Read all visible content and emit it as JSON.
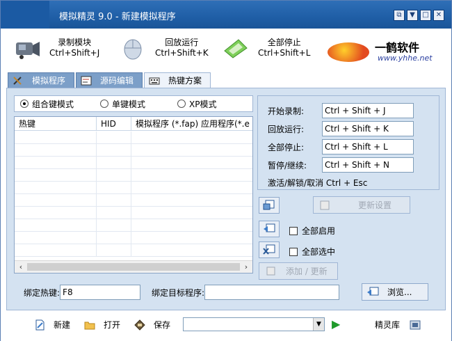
{
  "window": {
    "title": "模拟精灵 9.0 - 新建模拟程序",
    "controls": [
      "restore",
      "minimize",
      "maximize",
      "close"
    ]
  },
  "toolbar": {
    "record": {
      "label": "录制模块",
      "shortcut": "Ctrl+Shift+J",
      "icon": "camera-icon"
    },
    "playback": {
      "label": "回放运行",
      "shortcut": "Ctrl+Shift+K",
      "icon": "mouse-icon"
    },
    "stop_all": {
      "label": "全部停止",
      "shortcut": "Ctrl+Shift+L",
      "icon": "stop-icon"
    },
    "brand": {
      "name": "一鹤软件",
      "url": "www.yhhe.net"
    }
  },
  "tabs": [
    {
      "label": "模拟程序",
      "active": false
    },
    {
      "label": "源码编辑",
      "active": false
    },
    {
      "label": "热键方案",
      "active": true
    }
  ],
  "mode": {
    "options": [
      "组合键模式",
      "单键模式",
      "XP模式"
    ],
    "selected": "组合键模式"
  },
  "table": {
    "columns": [
      "热键",
      "HID",
      "模拟程序 (*.fap) 应用程序(*.e"
    ],
    "rows": []
  },
  "hotkeys": {
    "start_record": {
      "label": "开始录制:",
      "value": "Ctrl + Shift + J"
    },
    "playback": {
      "label": "回放运行:",
      "value": "Ctrl + Shift + K"
    },
    "stop_all": {
      "label": "全部停止:",
      "value": "Ctrl + Shift + L"
    },
    "pause": {
      "label": "暂停/继续:",
      "value": "Ctrl + Shift + N"
    },
    "note": "激活/解锁/取消 Ctrl + Esc"
  },
  "actions": {
    "update_settings": "更新设置",
    "enable_all": "全部启用",
    "select_all": "全部选中",
    "add_update": "添加 / 更新"
  },
  "binding": {
    "hotkey_label": "绑定热键:",
    "hotkey_value": "F8",
    "target_label": "绑定目标程序:",
    "target_value": "",
    "browse": "浏览..."
  },
  "bottom": {
    "new": "新建",
    "open": "打开",
    "save": "保存",
    "combo_value": "",
    "library": "精灵库"
  },
  "colors": {
    "titlebar": "#1f5ea6",
    "panel": "#d4e2f1",
    "tab_inactive": "#7c9fc8"
  }
}
